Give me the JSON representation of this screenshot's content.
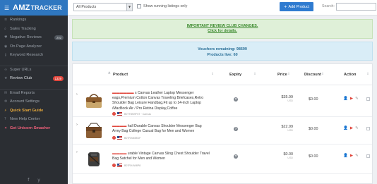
{
  "brand": {
    "name": "AMZ",
    "suffix": "TRACKER",
    "menu_icon": "hamburger-icon"
  },
  "sidebar": {
    "items": [
      {
        "label": "Rankings",
        "icon": "list-icon"
      },
      {
        "label": "Sales Tracking",
        "icon": "search-icon"
      },
      {
        "label": "Negative Reviews",
        "icon": "heart-icon",
        "badge": "202"
      },
      {
        "label": "On Page Analyzer",
        "icon": "eye-icon"
      },
      {
        "label": "Keyword Research",
        "icon": "key-icon"
      },
      {
        "label": "Super URLs",
        "icon": "link-icon"
      },
      {
        "label": "Review Club",
        "icon": "star-icon",
        "badge": "1329"
      },
      {
        "label": "Email Reports",
        "icon": "envelope-icon"
      },
      {
        "label": "Account Settings",
        "icon": "gear-icon"
      },
      {
        "label": "Quick Start Guide",
        "icon": "bolt-icon"
      },
      {
        "label": "New Help Center",
        "icon": "help-icon"
      },
      {
        "label": "Get Unicorn Smasher",
        "icon": "unicorn-icon"
      }
    ],
    "footer_icons": [
      "f",
      "y"
    ]
  },
  "topbar": {
    "filter_value": "All Products",
    "running_only_label": "Show running listings only",
    "add_button_label": "Add Product",
    "search_label": "Search:",
    "search_value": ""
  },
  "banners": {
    "changes_line1": "IMPORTANT REVIEW CLUB CHANGES.",
    "changes_line2": "Click for details.",
    "vouchers_line": "Vouchers remaining: 98699",
    "products_line": "Products live: 60"
  },
  "table": {
    "headers": {
      "product": "Product",
      "expiry": "Expiry",
      "price": "Price",
      "discount": "Discount",
      "action": "Action"
    },
    "rows": [
      {
        "title": "s Canvas Leather Laptop Messenger ...",
        "title_lines": [
          "s Canvas Leather Laptop Messenger",
          "eags,Premium Cotton Canvas Traveling Briefcases,Retro",
          "Shoulder Bag Leisure Handbag,Fit up to 14-inch Laptop",
          "/MacBook Air / Pro Retina Display,Coffee"
        ],
        "meta": "B07TBNHF6T · Canvas",
        "price": "$35.99",
        "currency": "USD",
        "discount": "$0.00"
      },
      {
        "title_lines": [
          "hall Durable Canvas Shoulder Messenger Bag",
          "Army Bag College Casual Bag for Men and Women"
        ],
        "meta": "B07RX8M8GF",
        "price": "$22.99",
        "currency": "USD",
        "discount": "$0.00"
      },
      {
        "title_lines": [
          "urable Vintage Canvas Sling Chest Shoulder Travel",
          "Bag Satchel for Men and Women"
        ],
        "meta": "B07RX4W8P8",
        "price": "$0.00",
        "currency": "USD",
        "discount": "$0.00"
      }
    ]
  },
  "colors": {
    "accent": "#2f7bd0",
    "sidebar": "#2b2e33",
    "danger": "#e0463c",
    "success_bg": "#dff0d8",
    "info_bg": "#d9edf7"
  }
}
